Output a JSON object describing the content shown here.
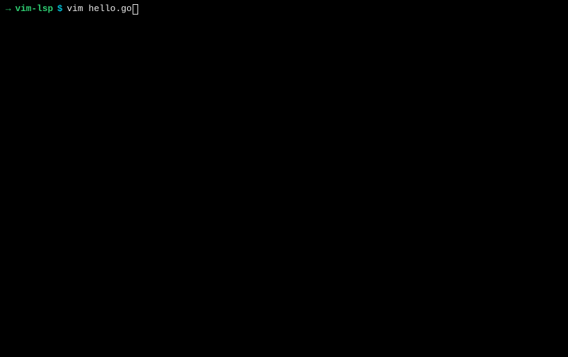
{
  "prompt": {
    "arrow": "→",
    "directory": "vim-lsp",
    "symbol": "$",
    "command": "vim hello.go"
  }
}
